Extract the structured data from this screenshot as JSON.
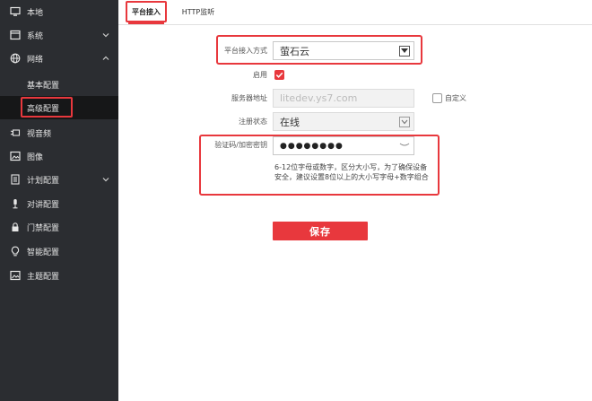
{
  "sidebar": {
    "items": [
      {
        "label": "本地",
        "icon": "monitor-icon"
      },
      {
        "label": "系统",
        "icon": "window-icon"
      },
      {
        "label": "网络",
        "icon": "globe-icon"
      },
      {
        "label": "视音频",
        "icon": "camera-icon"
      },
      {
        "label": "图像",
        "icon": "image-icon"
      },
      {
        "label": "计划配置",
        "icon": "calendar-icon"
      },
      {
        "label": "对讲配置",
        "icon": "microphone-icon"
      },
      {
        "label": "门禁配置",
        "icon": "lock-icon"
      },
      {
        "label": "智能配置",
        "icon": "bulb-icon"
      },
      {
        "label": "主题配置",
        "icon": "picture-icon"
      }
    ],
    "network_sub": [
      {
        "label": "基本配置"
      },
      {
        "label": "高级配置"
      }
    ]
  },
  "tabs": [
    {
      "label": "平台接入"
    },
    {
      "label": "HTTP监听"
    }
  ],
  "form": {
    "access_mode_label": "平台接入方式",
    "access_mode_value": "萤石云",
    "enable_label": "启用",
    "enable_checked": true,
    "server_label": "服务器地址",
    "server_value": "litedev.ys7.com",
    "custom_label": "自定义",
    "custom_checked": false,
    "reg_status_label": "注册状态",
    "reg_status_value": "在线",
    "verify_label": "验证码/加密密钥",
    "verify_value": "●●●●●●●●",
    "hint": "6-12位字母或数字，区分大小写，为了确保设备安全，建议设置8位以上的大小写字母+数字组合"
  },
  "buttons": {
    "save": "保存"
  },
  "colors": {
    "accent": "#e8383d",
    "sidebar_bg": "#2b2d31",
    "sidebar_active_bg": "#161718"
  }
}
